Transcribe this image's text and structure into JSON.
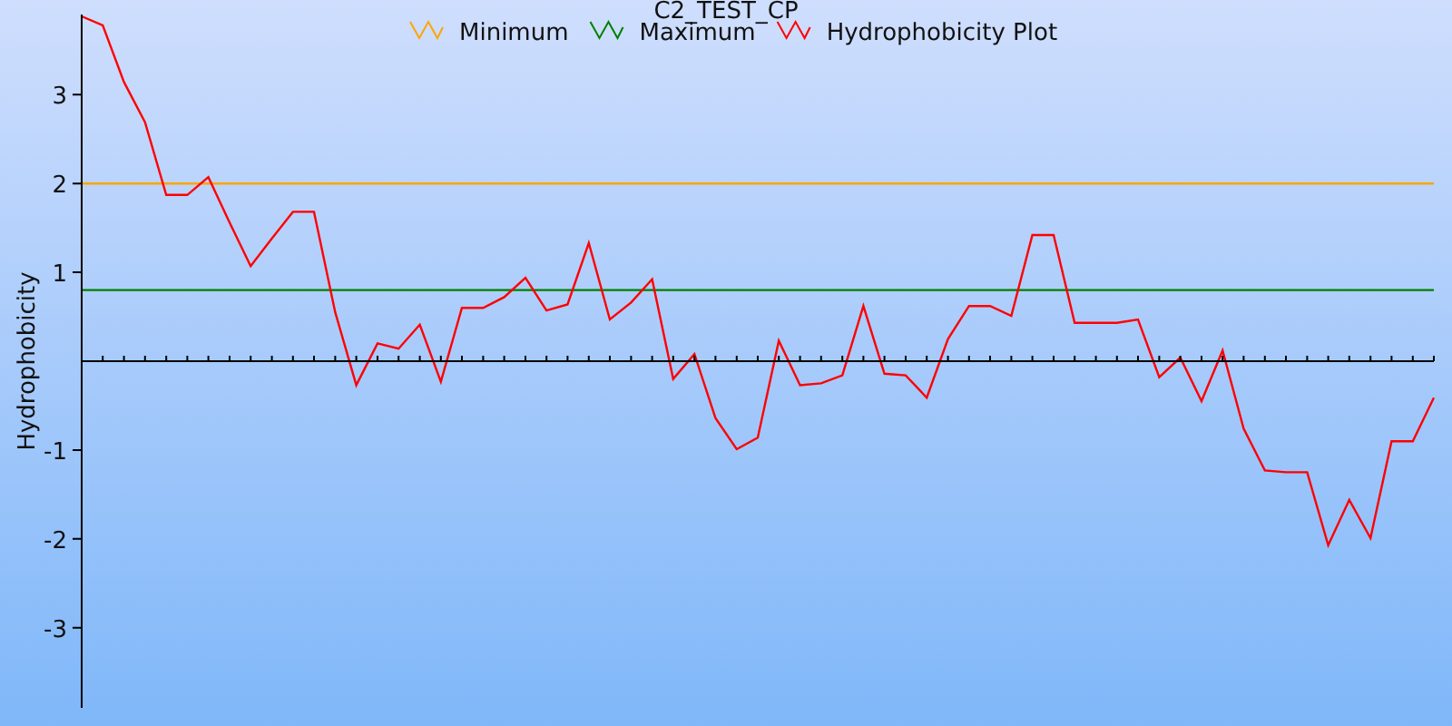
{
  "chart_data": {
    "type": "line",
    "title": "C2_TEST_CP",
    "legend": true,
    "ylabel": "Hydrophobicity",
    "ylim": [
      -3.9,
      3.9
    ],
    "yticks": [
      -3,
      -2,
      -1,
      1,
      2,
      3
    ],
    "series": [
      {
        "name": "Minimum",
        "color": "#ffa500",
        "values": [
          2,
          2,
          2,
          2,
          2,
          2,
          2,
          2,
          2,
          2,
          2,
          2,
          2,
          2,
          2,
          2,
          2,
          2,
          2,
          2,
          2,
          2,
          2,
          2,
          2,
          2,
          2,
          2,
          2,
          2,
          2,
          2,
          2,
          2,
          2,
          2,
          2,
          2,
          2,
          2,
          2,
          2,
          2,
          2,
          2,
          2,
          2,
          2,
          2,
          2,
          2,
          2,
          2,
          2,
          2,
          2,
          2,
          2,
          2,
          2,
          2,
          2,
          2,
          2,
          2
        ]
      },
      {
        "name": "Maximum",
        "color": "#008000",
        "values": [
          0.8,
          0.8,
          0.8,
          0.8,
          0.8,
          0.8,
          0.8,
          0.8,
          0.8,
          0.8,
          0.8,
          0.8,
          0.8,
          0.8,
          0.8,
          0.8,
          0.8,
          0.8,
          0.8,
          0.8,
          0.8,
          0.8,
          0.8,
          0.8,
          0.8,
          0.8,
          0.8,
          0.8,
          0.8,
          0.8,
          0.8,
          0.8,
          0.8,
          0.8,
          0.8,
          0.8,
          0.8,
          0.8,
          0.8,
          0.8,
          0.8,
          0.8,
          0.8,
          0.8,
          0.8,
          0.8,
          0.8,
          0.8,
          0.8,
          0.8,
          0.8,
          0.8,
          0.8,
          0.8,
          0.8,
          0.8,
          0.8,
          0.8,
          0.8,
          0.8,
          0.8,
          0.8,
          0.8,
          0.8,
          0.8
        ]
      },
      {
        "name": "Hydrophobicity Plot",
        "color": "#ff0000",
        "values": [
          3.88,
          3.78,
          3.14,
          2.69,
          1.87,
          1.87,
          2.07,
          1.56,
          1.07,
          1.38,
          1.68,
          1.68,
          0.55,
          -0.27,
          0.2,
          0.14,
          0.41,
          -0.23,
          0.6,
          0.6,
          0.72,
          0.94,
          0.57,
          0.64,
          1.33,
          0.47,
          0.66,
          0.92,
          -0.2,
          0.08,
          -0.64,
          -0.99,
          -0.86,
          0.23,
          -0.27,
          -0.25,
          -0.16,
          0.62,
          -0.14,
          -0.16,
          -0.41,
          0.25,
          0.62,
          0.62,
          0.51,
          1.42,
          1.42,
          0.43,
          0.43,
          0.43,
          0.47,
          -0.18,
          0.04,
          -0.45,
          0.12,
          -0.76,
          -1.23,
          -1.25,
          -1.25,
          -2.07,
          -1.56,
          -1.99,
          -0.9,
          -0.9,
          -0.41
        ]
      }
    ]
  }
}
